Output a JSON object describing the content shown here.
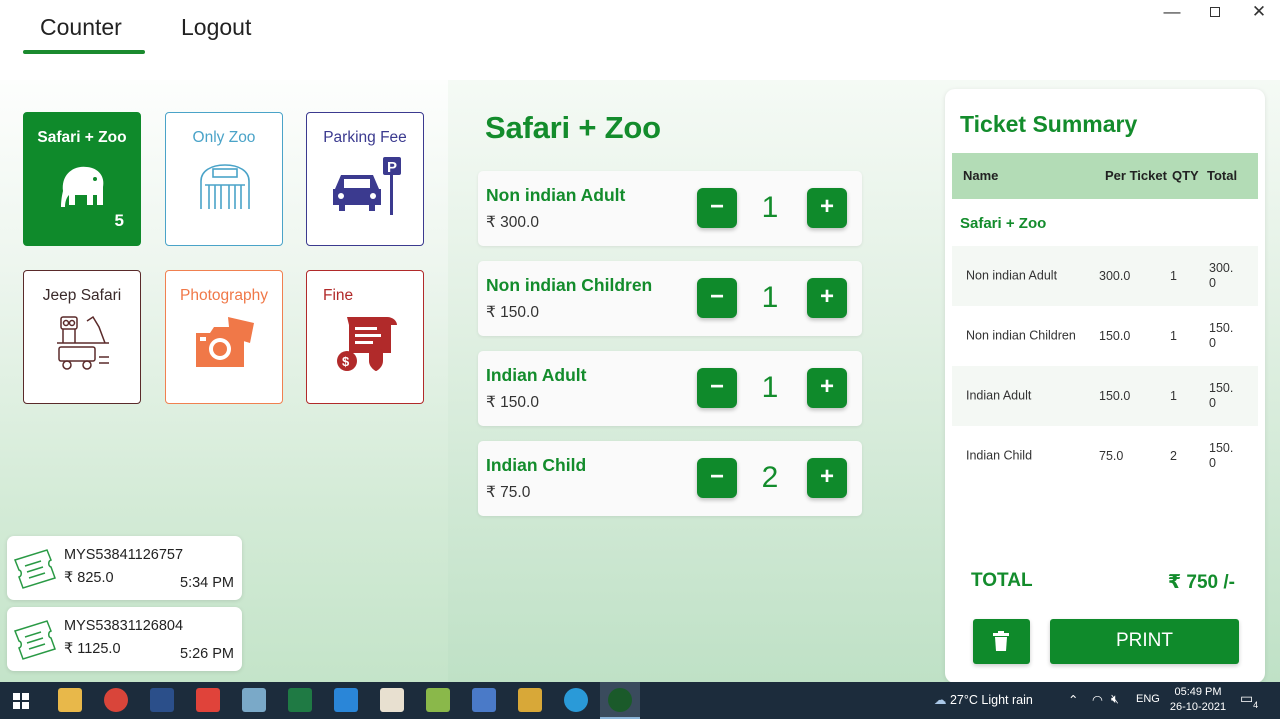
{
  "nav": {
    "tabs": [
      {
        "label": "Counter",
        "active": true
      },
      {
        "label": "Logout",
        "active": false
      }
    ]
  },
  "window_controls": {
    "minimize": "—",
    "close": "✕"
  },
  "categories": [
    {
      "label": "Safari + Zoo",
      "icon": "elephant-icon",
      "count": "5",
      "active": true,
      "color": "#0f8a2b"
    },
    {
      "label": "Only Zoo",
      "icon": "zoo-gate-icon",
      "active": false,
      "color": "#4aa3c8"
    },
    {
      "label": "Parking Fee",
      "icon": "parking-car-icon",
      "active": false,
      "color": "#3b3a8f"
    },
    {
      "label": "Jeep Safari",
      "icon": "jeep-safari-icon",
      "active": false,
      "color": "#5a2a2a"
    },
    {
      "label": "Photography",
      "icon": "camera-icon",
      "active": false,
      "color": "#f08050"
    },
    {
      "label": "Fine",
      "icon": "fine-receipt-icon",
      "active": false,
      "color": "#b12a2a"
    }
  ],
  "selected_category": "Safari + Zoo",
  "tickets": [
    {
      "name": "Non indian Adult",
      "price": "₹ 300.0",
      "qty": "1"
    },
    {
      "name": "Non indian Children",
      "price": "₹ 150.0",
      "qty": "1"
    },
    {
      "name": "Indian Adult",
      "price": "₹ 150.0",
      "qty": "1"
    },
    {
      "name": "Indian Child",
      "price": "₹ 75.0",
      "qty": "2"
    }
  ],
  "qty_buttons": {
    "minus": "−",
    "plus": "+"
  },
  "history": [
    {
      "id": "MYS53841126757",
      "amount": "₹ 825.0",
      "time": "5:34 PM"
    },
    {
      "id": "MYS53831126804",
      "amount": "₹ 1125.0",
      "time": "5:26 PM"
    }
  ],
  "summary": {
    "title": "Ticket Summary",
    "headers": {
      "name": "Name",
      "per_ticket": "Per Ticket",
      "qty": "QTY",
      "total": "Total"
    },
    "group": "Safari + Zoo",
    "rows": [
      {
        "name": "Non indian Adult",
        "per": "300.0",
        "qty": "1",
        "total": "300.0"
      },
      {
        "name": "Non indian Children",
        "per": "150.0",
        "qty": "1",
        "total": "150.0"
      },
      {
        "name": "Indian Adult",
        "per": "150.0",
        "qty": "1",
        "total": "150.0"
      },
      {
        "name": "Indian Child",
        "per": "75.0",
        "qty": "2",
        "total": "150.0"
      }
    ],
    "total_label": "TOTAL",
    "total_value": "₹ 750 /-",
    "print_label": "PRINT"
  },
  "taskbar": {
    "weather": "27°C  Light rain",
    "lang": "ENG",
    "time": "05:49 PM",
    "date": "26-10-2021",
    "notifications": "4"
  },
  "colors": {
    "accent": "#0f8a2b",
    "accent_light": "#b3dcb6",
    "taskbar": "#1c2c3c"
  }
}
